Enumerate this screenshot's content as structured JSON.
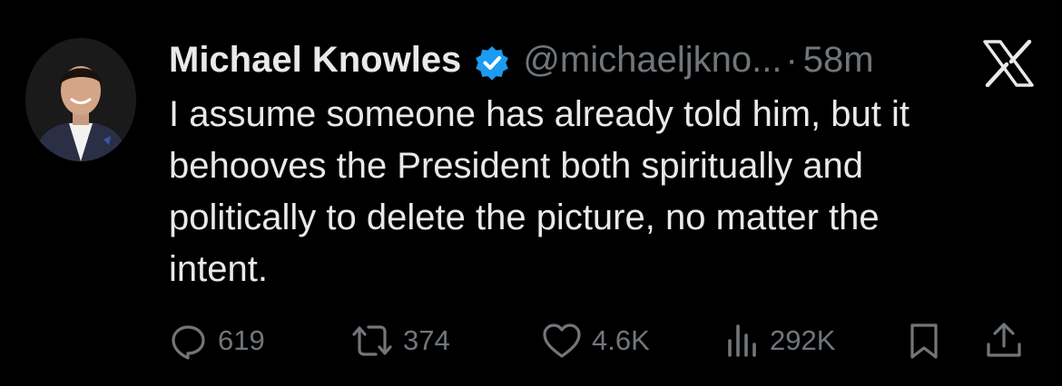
{
  "author": {
    "display_name": "Michael Knowles",
    "handle": "@michaeljkno...",
    "separator": "·",
    "time": "58m",
    "verified": true,
    "avatar_icon": "profile-photo"
  },
  "tweet": {
    "text": "I assume someone has already told him, but it\nbehooves the President both spiritually and\npolitically to delete the picture, no matter the\nintent."
  },
  "actions": {
    "replies": "619",
    "retweets": "374",
    "likes": "4.6K",
    "views": "292K"
  },
  "icons": {
    "platform": "x-logo-icon",
    "reply": "reply-icon",
    "retweet": "retweet-icon",
    "like": "heart-icon",
    "views": "views-icon",
    "bookmark": "bookmark-icon",
    "share": "share-icon"
  },
  "colors": {
    "background": "#000000",
    "text": "#e7e9ea",
    "secondary": "#71767b",
    "verified": "#1d9bf0"
  }
}
